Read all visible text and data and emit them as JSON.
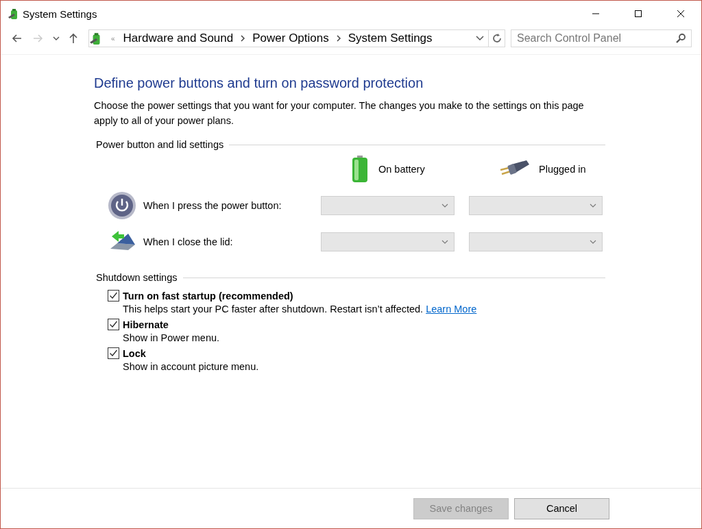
{
  "window": {
    "title": "System Settings"
  },
  "address_bar": {
    "overflow_marker": "«",
    "breadcrumbs": [
      "Hardware and Sound",
      "Power Options",
      "System Settings"
    ]
  },
  "search": {
    "placeholder": "Search Control Panel"
  },
  "heading": "Define power buttons and turn on password protection",
  "description": "Choose the power settings that you want for your computer. The changes you make to the settings on this page apply to all of your power plans.",
  "power_section": {
    "title": "Power button and lid settings",
    "columns": [
      {
        "label": "On battery",
        "kind": "battery"
      },
      {
        "label": "Plugged in",
        "kind": "plug"
      }
    ],
    "rows": [
      {
        "label": "When I press the power button:",
        "kind": "power",
        "dropdowns": [
          {
            "disabled": true
          },
          {
            "disabled": true
          }
        ]
      },
      {
        "label": "When I close the lid:",
        "kind": "lid",
        "dropdowns": [
          {
            "disabled": true
          },
          {
            "disabled": true
          }
        ]
      }
    ]
  },
  "shutdown_section": {
    "title": "Shutdown settings",
    "options": [
      {
        "label": "Turn on fast startup (recommended)",
        "checked": true,
        "description": "This helps start your PC faster after shutdown. Restart isn’t affected.",
        "link": "Learn More"
      },
      {
        "label": "Hibernate",
        "checked": true,
        "description": "Show in Power menu."
      },
      {
        "label": "Lock",
        "checked": true,
        "description": "Show in account picture menu."
      }
    ]
  },
  "buttons": [
    {
      "label": "Save changes",
      "disabled": true
    },
    {
      "label": "Cancel",
      "disabled": false
    }
  ]
}
